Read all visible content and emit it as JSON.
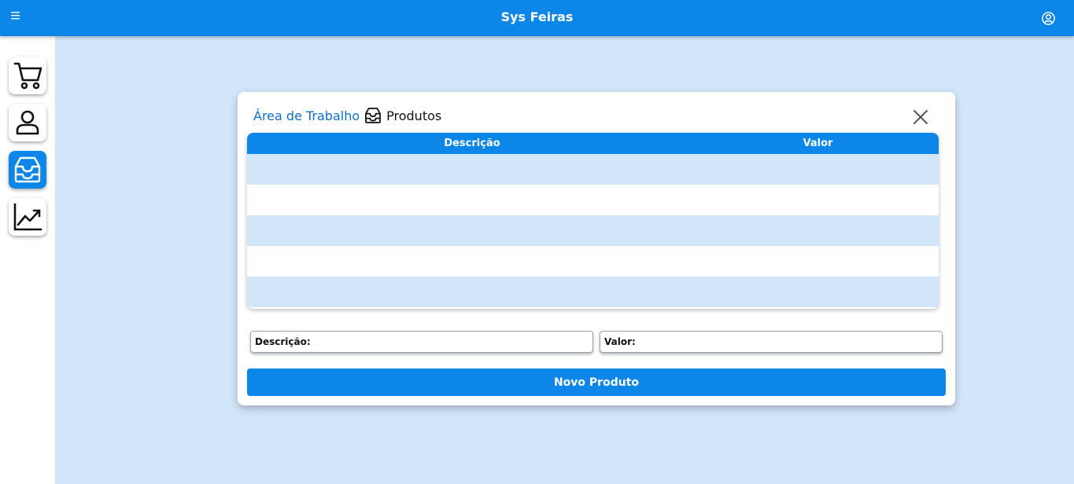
{
  "header": {
    "title": "Sys Feiras",
    "menu_icon": "hamburger-icon",
    "user_icon": "user-circle-icon",
    "color": "#0c86e8"
  },
  "sidebar": {
    "items": [
      {
        "icon": "cart-icon",
        "active": false
      },
      {
        "icon": "user-icon",
        "active": false
      },
      {
        "icon": "inbox-tray-icon",
        "active": true
      },
      {
        "icon": "chart-trend-icon",
        "active": false
      }
    ]
  },
  "dialog": {
    "breadcrumb": {
      "root": "Área de Trabalho",
      "icon": "inbox-tray-icon",
      "current": "Produtos"
    },
    "close_icon": "close-icon",
    "table": {
      "columns": [
        "Descrição",
        "Valor"
      ],
      "rows": [
        {
          "descricao": "",
          "valor": ""
        },
        {
          "descricao": "",
          "valor": ""
        },
        {
          "descricao": "",
          "valor": ""
        },
        {
          "descricao": "",
          "valor": ""
        },
        {
          "descricao": "",
          "valor": ""
        }
      ]
    },
    "form": {
      "descricao_label": "Descrição:",
      "descricao_value": "",
      "valor_label": "Valor:",
      "valor_value": ""
    },
    "submit_label": "Novo Produto"
  },
  "colors": {
    "primary": "#0c86e8",
    "background": "#d2e6f9",
    "link": "#0c6fd1"
  }
}
